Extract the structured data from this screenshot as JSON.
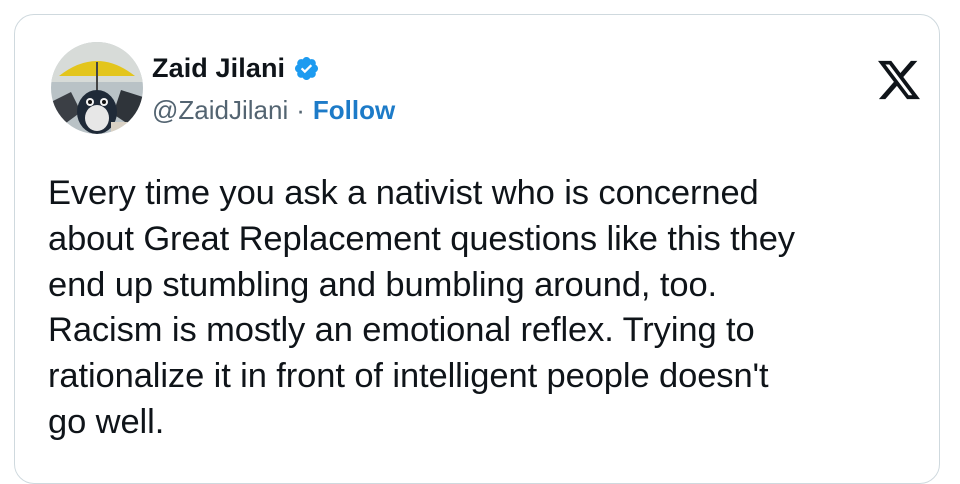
{
  "tweet": {
    "author_name": "Zaid Jilani",
    "handle": "@ZaidJilani",
    "separator": "·",
    "follow_label": "Follow",
    "verified": true,
    "body": "Every time you ask a nativist who is concerned\nabout Great Replacement questions like this they\nend up stumbling and bumbling around, too.\nRacism is mostly an emotional reflex. Trying to\nrationalize it in front of intelligent people doesn't\ngo well."
  },
  "icons": {
    "verified": "verified-badge-icon",
    "platform": "x-logo-icon"
  },
  "colors": {
    "follow_link": "#1d7bc8",
    "verified_badge": "#1d9bf0",
    "card_border": "#cfd9de",
    "secondary_text": "#536471"
  }
}
